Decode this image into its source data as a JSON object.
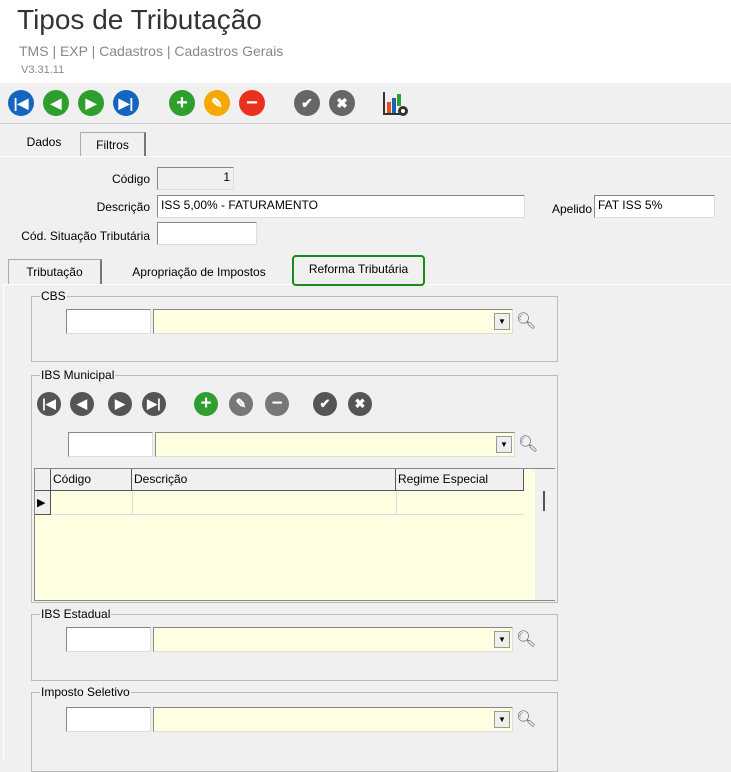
{
  "header": {
    "title": "Tipos de Tributação",
    "breadcrumb": "TMS | EXP | Cadastros | Cadastros Gerais",
    "version": "V3.31.11"
  },
  "toolbar": {
    "first": "first-icon",
    "prev": "previous-icon",
    "next": "next-icon",
    "last": "last-icon",
    "add": "add-icon",
    "edit": "edit-icon",
    "delete": "delete-icon",
    "confirm": "check-icon",
    "cancel": "cancel-icon",
    "report": "chart-settings-icon"
  },
  "tabs": [
    {
      "label": "Dados"
    },
    {
      "label": "Filtros"
    }
  ],
  "form": {
    "codigo_label": "Código",
    "codigo_value": "1",
    "descricao_label": "Descrição",
    "descricao_value": "ISS 5,00% - FATURAMENTO",
    "apelido_label": "Apelido",
    "apelido_value": "FAT ISS 5%",
    "cst_label": "Cód. Situação Tributária",
    "cst_value": ""
  },
  "subtabs": [
    {
      "label": "Tributação"
    },
    {
      "label": "Apropriação de Impostos"
    },
    {
      "label": "Reforma Tributária"
    }
  ],
  "groups": {
    "cbs": "CBS",
    "ibs_municipal": "IBS Municipal",
    "ibs_estadual": "IBS Estadual",
    "imposto_seletivo": "Imposto Seletivo"
  },
  "grid": {
    "columns": [
      "Código",
      "Descrição",
      "Regime Especial"
    ]
  },
  "colors": {
    "blue": "#1565c0",
    "green": "#2e9e2e",
    "orange": "#f5a800",
    "red": "#e8321e",
    "gray": "#666666",
    "active_tab_border": "#1a8a1a",
    "field_bg": "#ffffe1"
  }
}
